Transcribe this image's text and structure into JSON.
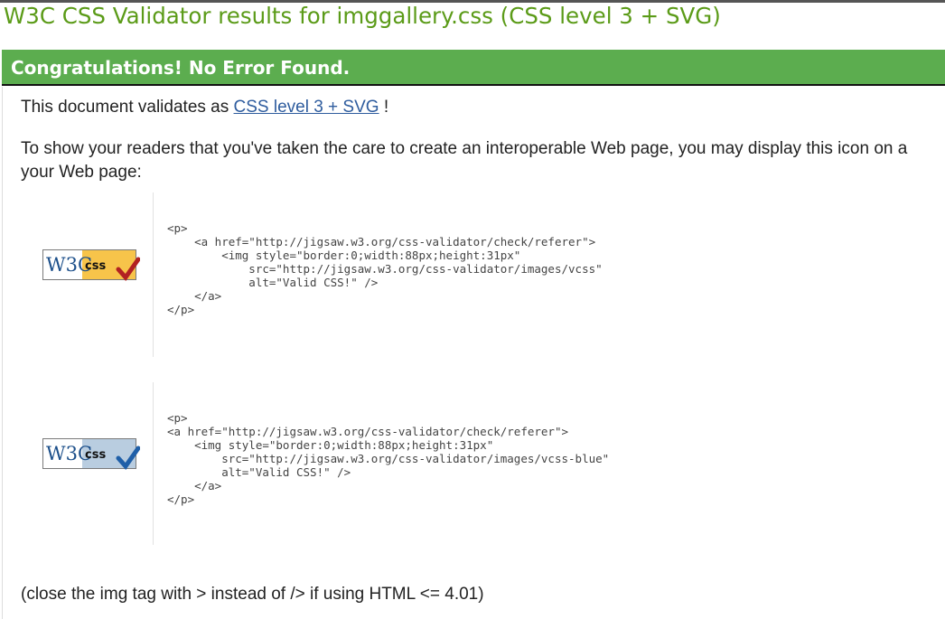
{
  "page": {
    "title": "W3C CSS Validator results for imggallery.css (CSS level 3 + SVG)"
  },
  "banner": {
    "text": "Congratulations! No Error Found."
  },
  "validates": {
    "prefix": "This document validates as ",
    "link_text": "CSS level 3 + SVG",
    "suffix": " !"
  },
  "readers": {
    "line1": "To show your readers that you've taken the care to create an interoperable Web page, you may display this icon on a",
    "line2": "your Web page:"
  },
  "badges": [
    {
      "logo_w3c": "W3C",
      "logo_css": "css",
      "code": "<p>\n    <a href=\"http://jigsaw.w3.org/css-validator/check/referer\">\n        <img style=\"border:0;width:88px;height:31px\"\n            src=\"http://jigsaw.w3.org/css-validator/images/vcss\"\n            alt=\"Valid CSS!\" />\n    </a>\n</p>"
    },
    {
      "logo_w3c": "W3C",
      "logo_css": "css",
      "code": "<p>\n<a href=\"http://jigsaw.w3.org/css-validator/check/referer\">\n    <img style=\"border:0;width:88px;height:31px\"\n        src=\"http://jigsaw.w3.org/css-validator/images/vcss-blue\"\n        alt=\"Valid CSS!\" />\n    </a>\n</p>"
    }
  ],
  "closing": {
    "text": "(close the img tag with > instead of /> if using HTML <= 4.01)"
  },
  "colors": {
    "title": "#5b9b18",
    "banner_bg": "#5cad4f",
    "link": "#2e5c9e",
    "badge_gold": "#f7c44a",
    "badge_blue": "#b9cde0",
    "check_red": "#b22222",
    "check_blue": "#1f5fa8"
  }
}
